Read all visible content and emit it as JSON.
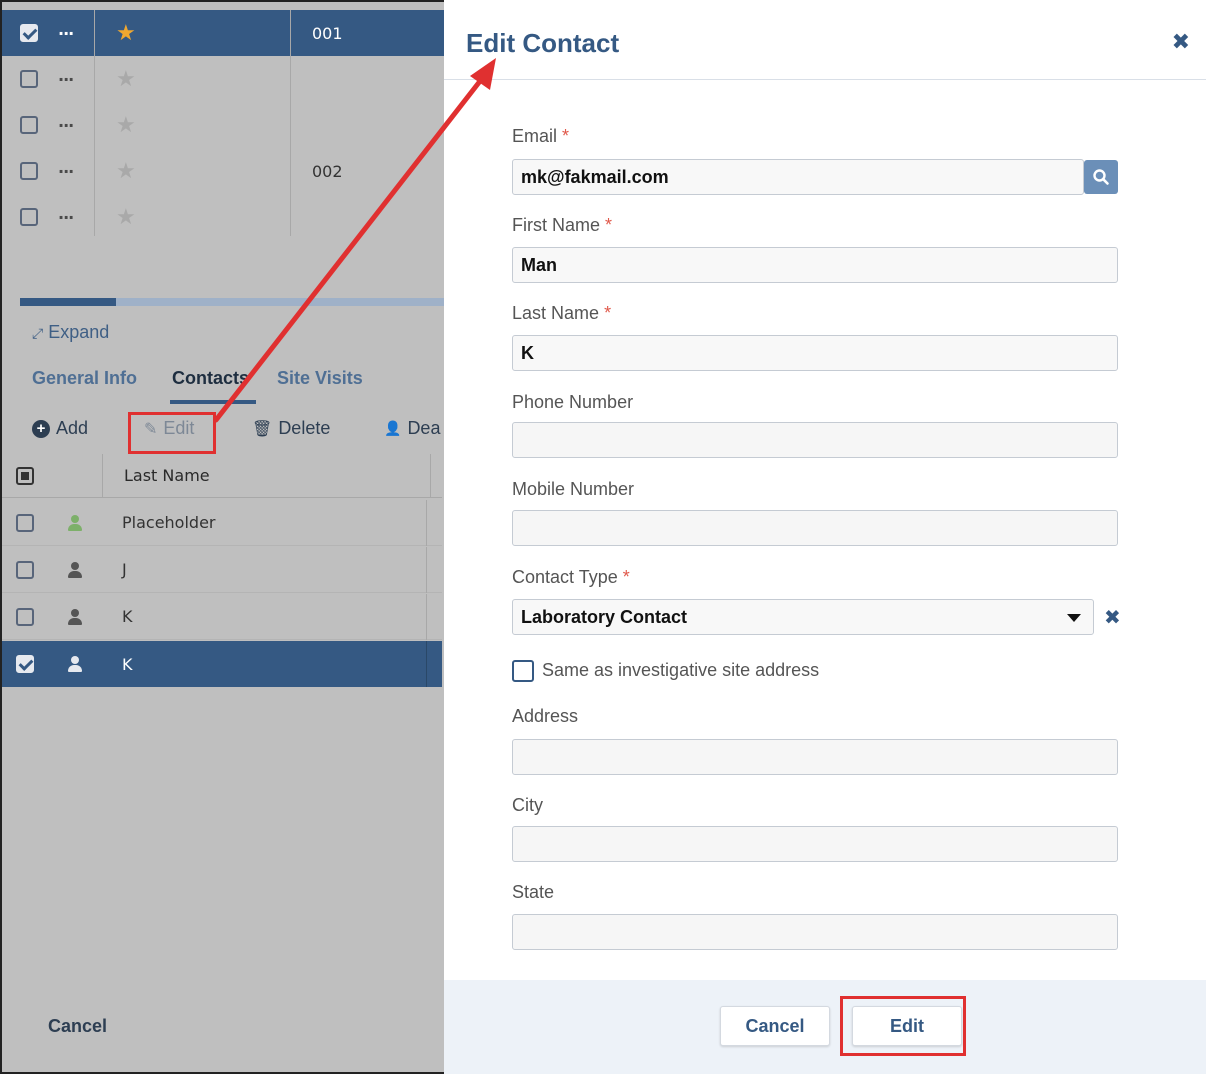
{
  "grid": {
    "rows": [
      {
        "checked": true,
        "starred": true,
        "code": "001",
        "selected": true
      },
      {
        "checked": false,
        "starred": false,
        "code": "",
        "selected": false
      },
      {
        "checked": false,
        "starred": false,
        "code": "",
        "selected": false
      },
      {
        "checked": false,
        "starred": false,
        "code": "002",
        "selected": false
      },
      {
        "checked": false,
        "starred": false,
        "code": "",
        "selected": false
      }
    ]
  },
  "detail": {
    "expand_label": "Expand",
    "tabs": [
      "General Info",
      "Contacts",
      "Site Visits"
    ],
    "active_tab": "Contacts",
    "toolbar": {
      "add": "Add",
      "edit": "Edit",
      "delete": "Delete",
      "deactivate": "Dea"
    },
    "contacts_header": "Last Name",
    "contacts": [
      {
        "name": "Placeholder",
        "icon_color": "#7db06a",
        "selected": false
      },
      {
        "name": "J",
        "icon_color": "#555555",
        "selected": false
      },
      {
        "name": "K",
        "icon_color": "#555555",
        "selected": false
      },
      {
        "name": "K",
        "icon_color": "#e6e9ef",
        "selected": true
      }
    ],
    "cancel_label": "Cancel"
  },
  "modal": {
    "title": "Edit Contact",
    "close_icon": "close-icon",
    "fields": {
      "email": {
        "label": "Email",
        "value": "mk@fakmail.com"
      },
      "first_name": {
        "label": "First Name",
        "value": "Man"
      },
      "last_name": {
        "label": "Last Name",
        "value": "K"
      },
      "phone": {
        "label": "Phone Number",
        "value": ""
      },
      "mobile": {
        "label": "Mobile Number",
        "value": ""
      },
      "contact_type": {
        "label": "Contact Type",
        "value": "Laboratory Contact"
      },
      "same_address": {
        "label": "Same as investigative site address",
        "checked": false
      },
      "address": {
        "label": "Address",
        "value": ""
      },
      "city": {
        "label": "City",
        "value": ""
      },
      "state": {
        "label": "State",
        "value": ""
      }
    },
    "required_mark": "*",
    "footer": {
      "cancel": "Cancel",
      "edit": "Edit"
    }
  },
  "colors": {
    "accent": "#355983",
    "highlight": "#e03030",
    "required": "#e0584a"
  }
}
